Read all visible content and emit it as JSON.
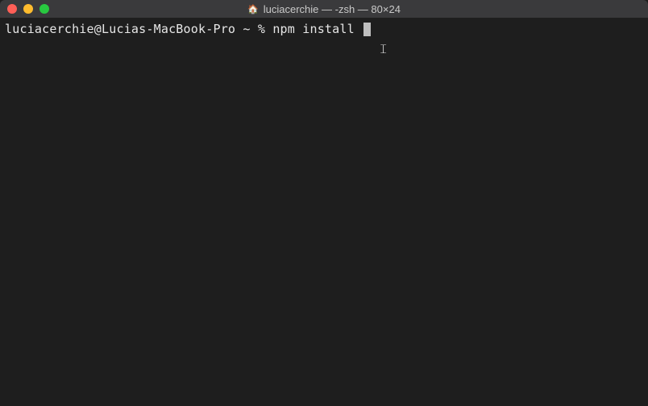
{
  "window": {
    "title": "luciacerchie — -zsh — 80×24",
    "home_icon": "🏠"
  },
  "terminal": {
    "prompt": "luciacerchie@Lucias-MacBook-Pro ~ % ",
    "command": "npm install ",
    "ibeam_glyph": "𝙸"
  },
  "colors": {
    "bg": "#1e1e1e",
    "titlebar": "#3a3a3c",
    "text": "#e6e6e6",
    "close": "#ff5f57",
    "minimize": "#febc2e",
    "zoom": "#28c840"
  }
}
